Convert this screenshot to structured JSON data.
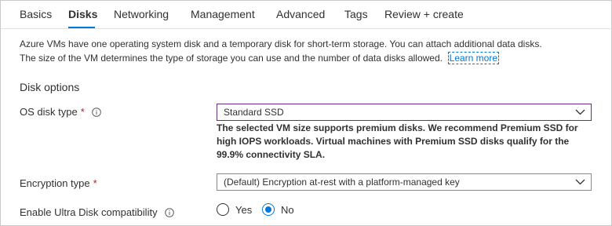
{
  "tabs": [
    {
      "label": "Basics",
      "active": false
    },
    {
      "label": "Disks",
      "active": true
    },
    {
      "label": "Networking",
      "active": false
    },
    {
      "label": "Management",
      "active": false
    },
    {
      "label": "Advanced",
      "active": false
    },
    {
      "label": "Tags",
      "active": false
    },
    {
      "label": "Review + create",
      "active": false
    }
  ],
  "description": {
    "line1": "Azure VMs have one operating system disk and a temporary disk for short-term storage. You can attach additional data disks.",
    "line2": "The size of the VM determines the type of storage you can use and the number of data disks allowed.",
    "learn_more": "Learn more"
  },
  "disk_options": {
    "title": "Disk options",
    "os_disk_type": {
      "label": "OS disk type",
      "required_mark": "*",
      "value": "Standard SSD",
      "hint_lines": [
        "The selected VM size supports premium disks. We recommend Premium SSD for",
        "high IOPS workloads. Virtual machines with Premium SSD disks qualify for the",
        "99.9% connectivity SLA."
      ]
    },
    "encryption_type": {
      "label": "Encryption type",
      "required_mark": "*",
      "value": "(Default) Encryption at-rest with a platform-managed key"
    },
    "ultra_disk": {
      "label": "Enable Ultra Disk compatibility",
      "options": [
        {
          "label": "Yes",
          "checked": false
        },
        {
          "label": "No",
          "checked": true
        }
      ]
    }
  },
  "colors": {
    "accent": "#0078d4",
    "focus_border": "#6b2a7e",
    "required": "#a4262c"
  }
}
